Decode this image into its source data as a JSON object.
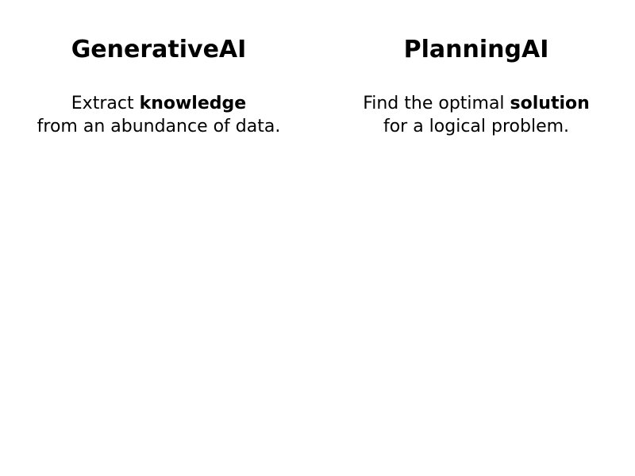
{
  "columns": [
    {
      "title": "GenerativeAI",
      "line1_prefix": "Extract ",
      "line1_bold": "knowledge",
      "line2": "from an abundance of data."
    },
    {
      "title": "PlanningAI",
      "line1_prefix": "Find the optimal ",
      "line1_bold": "solution",
      "line2": "for a logical problem."
    }
  ]
}
